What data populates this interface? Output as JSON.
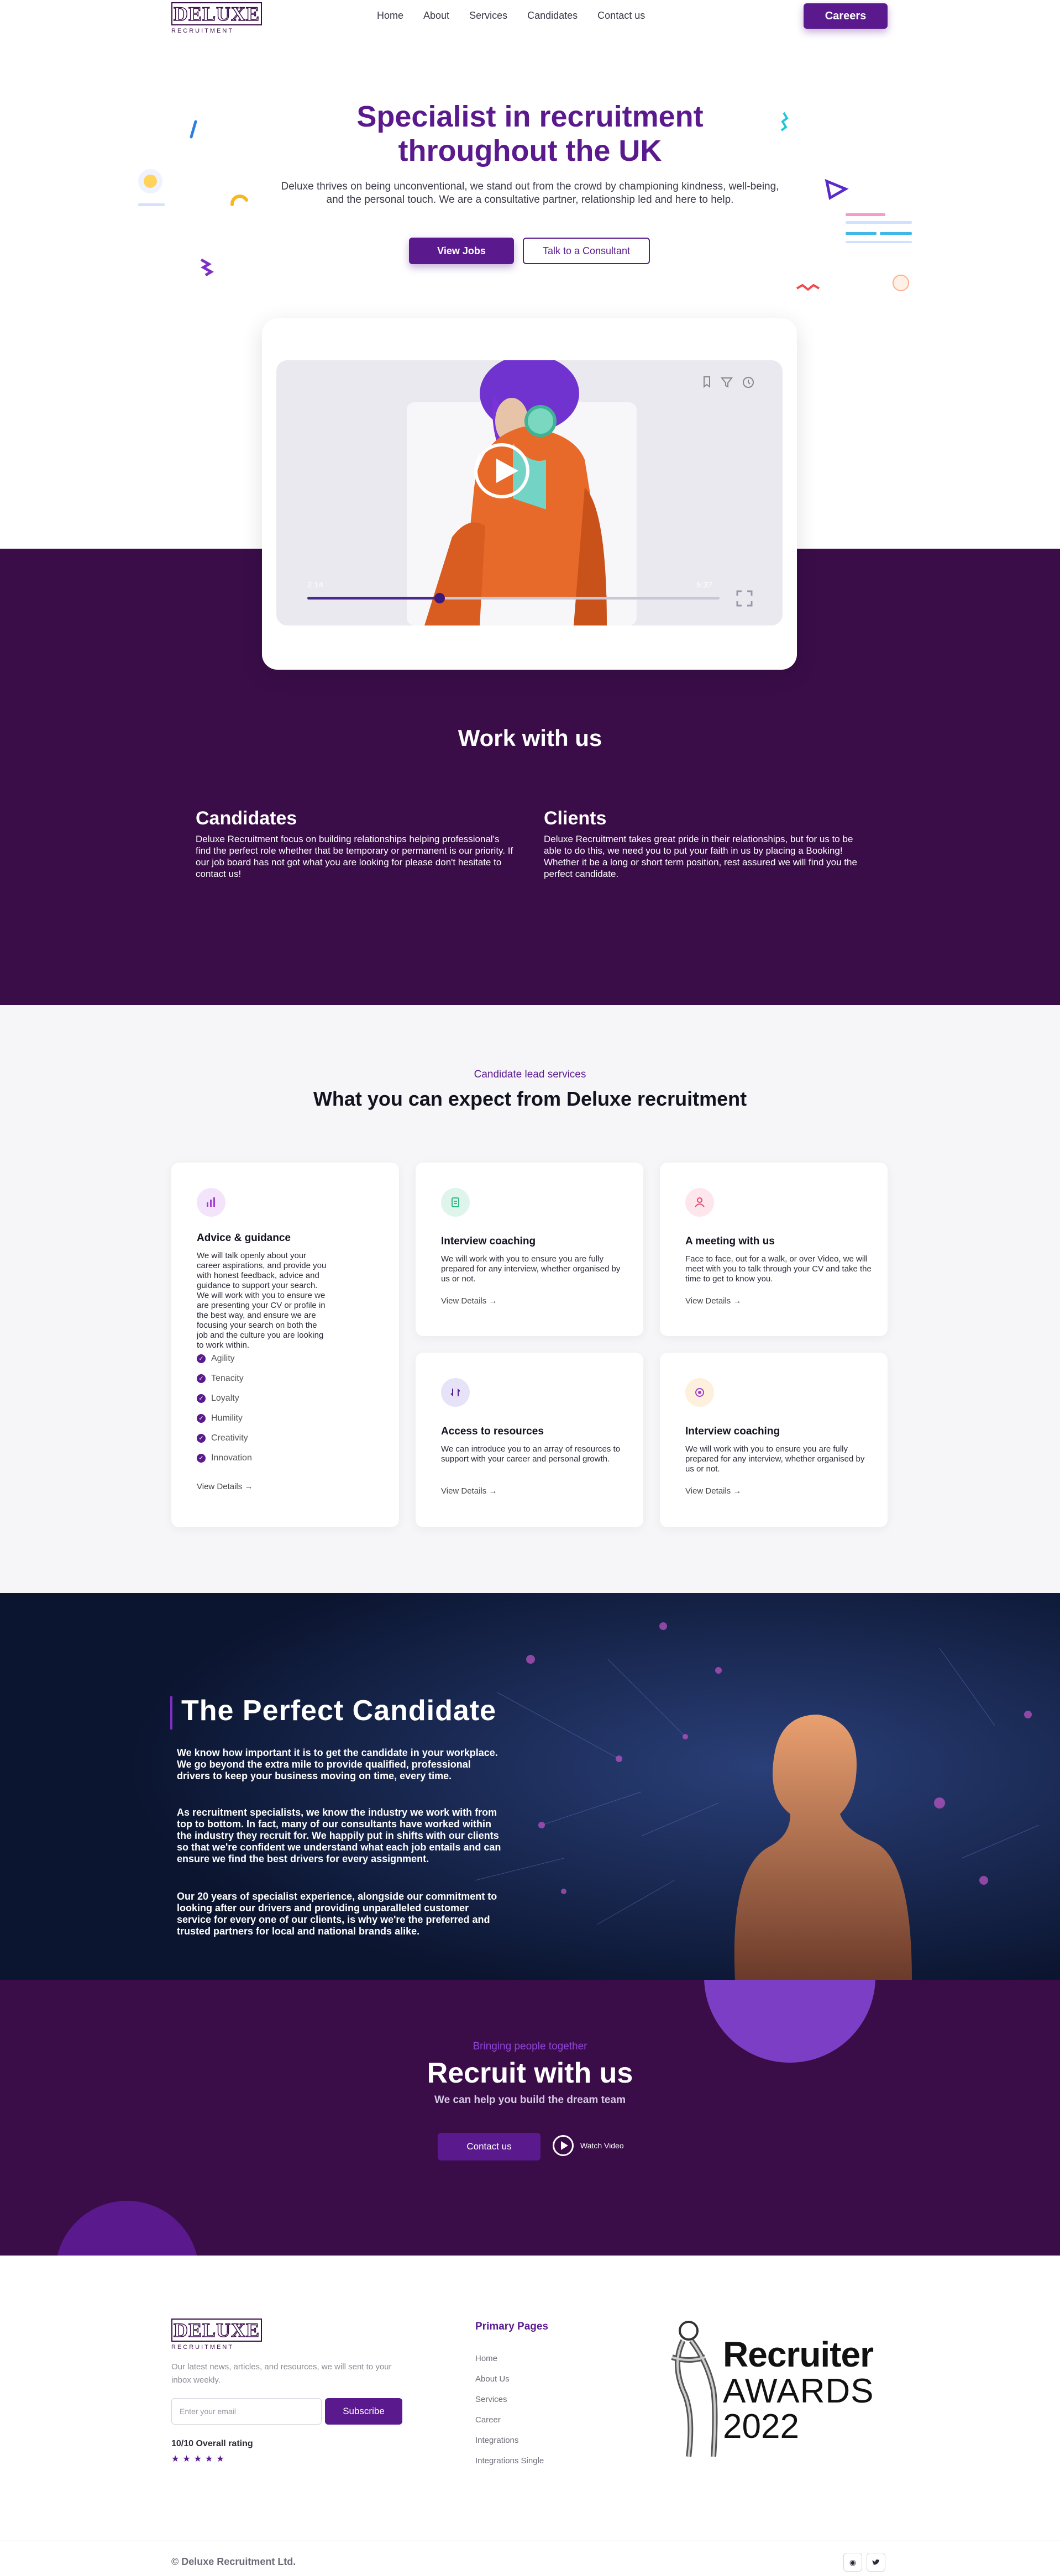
{
  "nav": {
    "logo_text": "DELUXE",
    "logo_sub": "RECRUITMENT",
    "links": [
      "Home",
      "About",
      "Services",
      "Candidates",
      "Contact us"
    ],
    "cta": "Careers"
  },
  "hero": {
    "title_line1": "Specialist in recruitment",
    "title_line2": "throughout the UK",
    "subtitle": "Deluxe thrives on being unconventional, we stand out from the crowd by championing kindness, well-being, and the personal touch. We are a consultative partner, relationship led and here to help.",
    "primary_button": "View Jobs",
    "secondary_button": "Talk to a Consultant"
  },
  "video": {
    "time_current": "2:14",
    "time_total": "5:37",
    "progress": 0.32
  },
  "work": {
    "title": "Work with us",
    "candidates_title": "Candidates",
    "candidates_text": "Deluxe Recruitment focus on building relationships helping professional's find the perfect role whether that be temporary or permanent is our priority. If our job board has not got what you are looking for please don't hesitate to contact us!",
    "clients_title": "Clients",
    "clients_text": "Deluxe Recruitment takes great pride in their relationships, but for us to be able to do this, we need you to put your faith in us by placing a Booking! Whether it be a long or short term position, rest assured we will find you the perfect candidate."
  },
  "services": {
    "eyebrow": "Candidate lead services",
    "title": "What you can expect from Deluxe recruitment",
    "view_details": "View Details",
    "advice": {
      "title": "Advice & guidance",
      "text": "We will talk openly about your career aspirations, and provide you with honest feedback, advice and guidance to support your search. We will work with you to ensure we are presenting your CV or profile in the best way, and ensure we are focusing your search on both the job and the culture you are looking to work within.",
      "values": [
        "Agility",
        "Tenacity",
        "Loyalty",
        "Humility",
        "Creativity",
        "Innovation"
      ]
    },
    "cards": [
      {
        "title": "Interview coaching",
        "text": "We will work with you to ensure you are fully prepared for any interview, whether organised by us or not.",
        "icon": "document-icon",
        "color": "#dff5ec"
      },
      {
        "title": "A meeting with us",
        "text": "Face to face, out for a walk, or over Video, we will meet with you to talk through your CV and take the time to get to know you.",
        "icon": "users-icon",
        "color": "#fde6ec"
      },
      {
        "title": "Access to resources",
        "text": "We can introduce you to an array of resources to support with your career and personal growth.",
        "icon": "swap-icon",
        "color": "#e6e2f8"
      },
      {
        "title": "Interview coaching",
        "text": "We will work with you to ensure you are fully prepared for any interview, whether organised by us or not.",
        "icon": "target-icon",
        "color": "#fdf0dc"
      }
    ]
  },
  "perfect": {
    "title": "The Perfect Candidate",
    "p1": "We know how important it is to get the candidate in your workplace. We go beyond the extra mile to provide qualified, professional drivers to keep your business moving on time, every time.",
    "p2": "As recruitment specialists, we know the industry we work with from top to bottom. In fact, many of our consultants have worked within the industry they recruit for. We happily put in shifts with our clients so that we're confident we understand what each job entails and can ensure we find the best drivers for every assignment.",
    "p3": "Our 20 years of specialist experience, alongside our commitment to looking after our drivers and providing unparalleled customer service for every one of our clients, is why we're the preferred and trusted partners for local and national brands alike."
  },
  "recruit": {
    "eyebrow": "Bringing people together",
    "title": "Recruit with us",
    "subtitle": "We can help you build the dream team",
    "button": "Contact us",
    "watch": "Watch Video"
  },
  "footer": {
    "text": "Our latest news, articles, and resources, we will sent to your inbox weekly.",
    "email_placeholder": "Enter your email",
    "subscribe": "Subscribe",
    "rating": "10/10 Overall rating",
    "stars": "★★★★★",
    "pages_title": "Primary Pages",
    "pages": [
      "Home",
      "About Us",
      "Services",
      "Career",
      "Integrations",
      "Integrations Single"
    ],
    "award_line1": "Recruiter",
    "award_line2": "AWARDS",
    "award_line3": "2022",
    "copyright": "© Deluxe Recruitment Ltd."
  },
  "colors": {
    "brand": "#5a1a8e",
    "dark": "#3a0d48"
  }
}
